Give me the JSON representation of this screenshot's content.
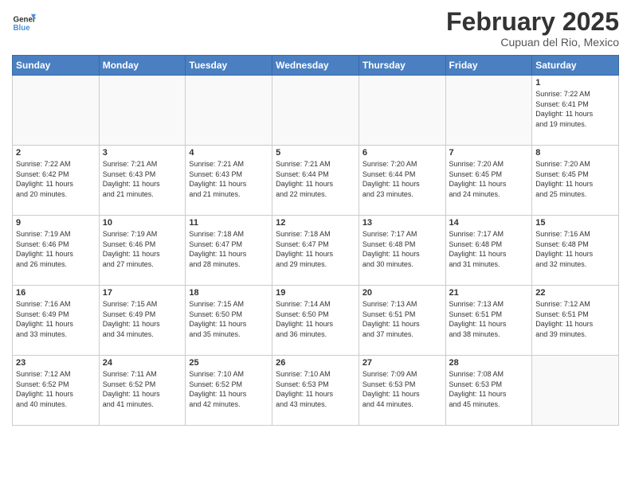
{
  "header": {
    "logo_line1": "General",
    "logo_line2": "Blue",
    "month_title": "February 2025",
    "location": "Cupuan del Rio, Mexico"
  },
  "weekdays": [
    "Sunday",
    "Monday",
    "Tuesday",
    "Wednesday",
    "Thursday",
    "Friday",
    "Saturday"
  ],
  "weeks": [
    [
      {
        "day": "",
        "info": ""
      },
      {
        "day": "",
        "info": ""
      },
      {
        "day": "",
        "info": ""
      },
      {
        "day": "",
        "info": ""
      },
      {
        "day": "",
        "info": ""
      },
      {
        "day": "",
        "info": ""
      },
      {
        "day": "1",
        "info": "Sunrise: 7:22 AM\nSunset: 6:41 PM\nDaylight: 11 hours\nand 19 minutes."
      }
    ],
    [
      {
        "day": "2",
        "info": "Sunrise: 7:22 AM\nSunset: 6:42 PM\nDaylight: 11 hours\nand 20 minutes."
      },
      {
        "day": "3",
        "info": "Sunrise: 7:21 AM\nSunset: 6:43 PM\nDaylight: 11 hours\nand 21 minutes."
      },
      {
        "day": "4",
        "info": "Sunrise: 7:21 AM\nSunset: 6:43 PM\nDaylight: 11 hours\nand 21 minutes."
      },
      {
        "day": "5",
        "info": "Sunrise: 7:21 AM\nSunset: 6:44 PM\nDaylight: 11 hours\nand 22 minutes."
      },
      {
        "day": "6",
        "info": "Sunrise: 7:20 AM\nSunset: 6:44 PM\nDaylight: 11 hours\nand 23 minutes."
      },
      {
        "day": "7",
        "info": "Sunrise: 7:20 AM\nSunset: 6:45 PM\nDaylight: 11 hours\nand 24 minutes."
      },
      {
        "day": "8",
        "info": "Sunrise: 7:20 AM\nSunset: 6:45 PM\nDaylight: 11 hours\nand 25 minutes."
      }
    ],
    [
      {
        "day": "9",
        "info": "Sunrise: 7:19 AM\nSunset: 6:46 PM\nDaylight: 11 hours\nand 26 minutes."
      },
      {
        "day": "10",
        "info": "Sunrise: 7:19 AM\nSunset: 6:46 PM\nDaylight: 11 hours\nand 27 minutes."
      },
      {
        "day": "11",
        "info": "Sunrise: 7:18 AM\nSunset: 6:47 PM\nDaylight: 11 hours\nand 28 minutes."
      },
      {
        "day": "12",
        "info": "Sunrise: 7:18 AM\nSunset: 6:47 PM\nDaylight: 11 hours\nand 29 minutes."
      },
      {
        "day": "13",
        "info": "Sunrise: 7:17 AM\nSunset: 6:48 PM\nDaylight: 11 hours\nand 30 minutes."
      },
      {
        "day": "14",
        "info": "Sunrise: 7:17 AM\nSunset: 6:48 PM\nDaylight: 11 hours\nand 31 minutes."
      },
      {
        "day": "15",
        "info": "Sunrise: 7:16 AM\nSunset: 6:48 PM\nDaylight: 11 hours\nand 32 minutes."
      }
    ],
    [
      {
        "day": "16",
        "info": "Sunrise: 7:16 AM\nSunset: 6:49 PM\nDaylight: 11 hours\nand 33 minutes."
      },
      {
        "day": "17",
        "info": "Sunrise: 7:15 AM\nSunset: 6:49 PM\nDaylight: 11 hours\nand 34 minutes."
      },
      {
        "day": "18",
        "info": "Sunrise: 7:15 AM\nSunset: 6:50 PM\nDaylight: 11 hours\nand 35 minutes."
      },
      {
        "day": "19",
        "info": "Sunrise: 7:14 AM\nSunset: 6:50 PM\nDaylight: 11 hours\nand 36 minutes."
      },
      {
        "day": "20",
        "info": "Sunrise: 7:13 AM\nSunset: 6:51 PM\nDaylight: 11 hours\nand 37 minutes."
      },
      {
        "day": "21",
        "info": "Sunrise: 7:13 AM\nSunset: 6:51 PM\nDaylight: 11 hours\nand 38 minutes."
      },
      {
        "day": "22",
        "info": "Sunrise: 7:12 AM\nSunset: 6:51 PM\nDaylight: 11 hours\nand 39 minutes."
      }
    ],
    [
      {
        "day": "23",
        "info": "Sunrise: 7:12 AM\nSunset: 6:52 PM\nDaylight: 11 hours\nand 40 minutes."
      },
      {
        "day": "24",
        "info": "Sunrise: 7:11 AM\nSunset: 6:52 PM\nDaylight: 11 hours\nand 41 minutes."
      },
      {
        "day": "25",
        "info": "Sunrise: 7:10 AM\nSunset: 6:52 PM\nDaylight: 11 hours\nand 42 minutes."
      },
      {
        "day": "26",
        "info": "Sunrise: 7:10 AM\nSunset: 6:53 PM\nDaylight: 11 hours\nand 43 minutes."
      },
      {
        "day": "27",
        "info": "Sunrise: 7:09 AM\nSunset: 6:53 PM\nDaylight: 11 hours\nand 44 minutes."
      },
      {
        "day": "28",
        "info": "Sunrise: 7:08 AM\nSunset: 6:53 PM\nDaylight: 11 hours\nand 45 minutes."
      },
      {
        "day": "",
        "info": ""
      }
    ]
  ]
}
